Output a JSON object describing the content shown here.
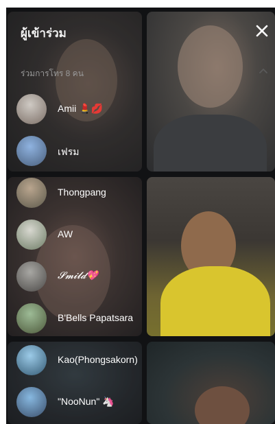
{
  "panel": {
    "title": "ผู้เข้าร่วม",
    "close_icon": "close-icon",
    "section_label": "ร่วมการโทร 8 คน",
    "collapse_icon": "chevron-up-icon"
  },
  "participants": [
    {
      "name": "Amii 💄💋",
      "avatar_colors": [
        "#cfcac4",
        "#7b6e66"
      ]
    },
    {
      "name": "เฟรม",
      "avatar_colors": [
        "#8fb3e0",
        "#4a5f7c"
      ]
    },
    {
      "name": "Thongpang",
      "avatar_colors": [
        "#b9a58e",
        "#5d5a4c"
      ]
    },
    {
      "name": "AW",
      "avatar_colors": [
        "#d8d8d0",
        "#6e7d66"
      ]
    },
    {
      "name": "𝓢𝓶𝓲𝓵𝓭💖",
      "avatar_colors": [
        "#a8a7a3",
        "#4c4a48"
      ]
    },
    {
      "name": "B'Bells Papatsara",
      "avatar_colors": [
        "#9dbb96",
        "#4e5a3c"
      ]
    },
    {
      "name": "Kao(Phongsakorn)",
      "avatar_colors": [
        "#9ccbe8",
        "#345a73"
      ]
    },
    {
      "name": "\"NooNun\" 🦄",
      "avatar_colors": [
        "#87b8e0",
        "#3b4f6b"
      ]
    }
  ]
}
